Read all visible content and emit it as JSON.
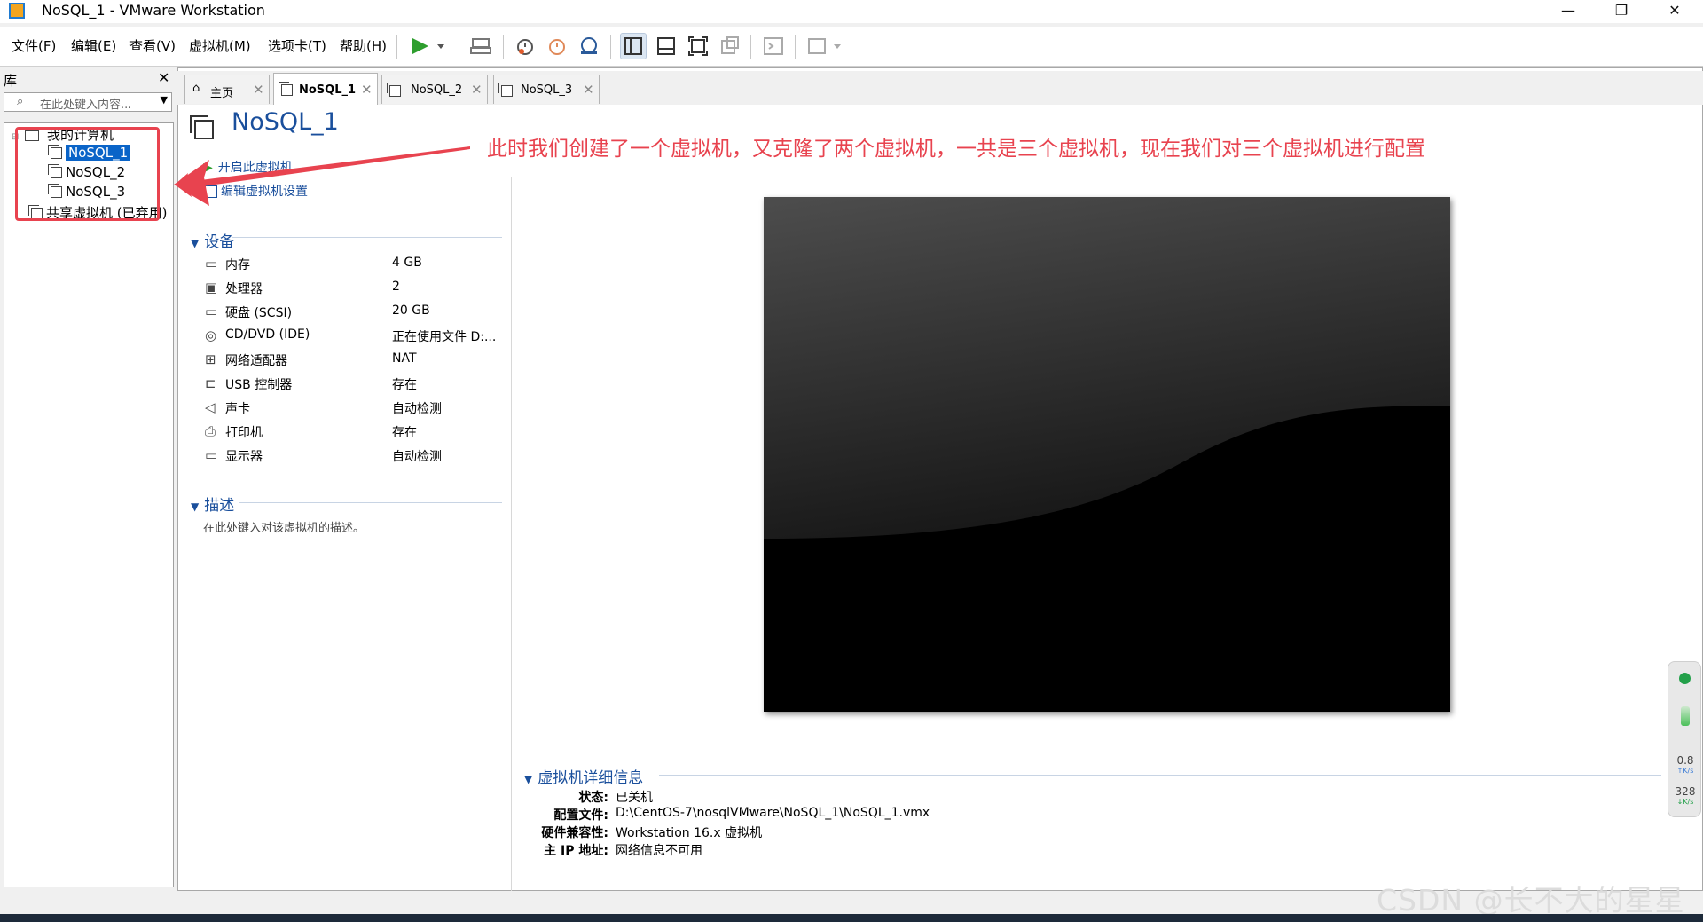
{
  "window": {
    "title": "NoSQL_1 - VMware Workstation",
    "controls": [
      "—",
      "❐",
      "✕"
    ]
  },
  "menu": [
    "文件(F)",
    "编辑(E)",
    "查看(V)",
    "虚拟机(M)",
    "选项卡(T)",
    "帮助(H)"
  ],
  "library": {
    "header": "库",
    "close": "✕",
    "search_placeholder": "在此处键入内容...",
    "tree": {
      "root": "我的计算机",
      "vms": [
        "NoSQL_1",
        "NoSQL_2",
        "NoSQL_3"
      ],
      "shared": "共享虚拟机 (已弃用)"
    }
  },
  "tabs": [
    {
      "label": "主页",
      "icon": "home-icon"
    },
    {
      "label": "NoSQL_1",
      "icon": "vm-icon"
    },
    {
      "label": "NoSQL_2",
      "icon": "vm-icon"
    },
    {
      "label": "NoSQL_3",
      "icon": "vm-icon"
    }
  ],
  "vm": {
    "name": "NoSQL_1",
    "actions": {
      "power_on": "开启此虚拟机",
      "edit_settings": "编辑虚拟机设置"
    },
    "devices_title": "设备",
    "devices": [
      {
        "name": "内存",
        "value": "4 GB",
        "icon": "memory-icon"
      },
      {
        "name": "处理器",
        "value": "2",
        "icon": "cpu-icon"
      },
      {
        "name": "硬盘 (SCSI)",
        "value": "20 GB",
        "icon": "disk-icon"
      },
      {
        "name": "CD/DVD (IDE)",
        "value": "正在使用文件 D:...",
        "icon": "cd-icon"
      },
      {
        "name": "网络适配器",
        "value": "NAT",
        "icon": "network-icon"
      },
      {
        "name": "USB 控制器",
        "value": "存在",
        "icon": "usb-icon"
      },
      {
        "name": "声卡",
        "value": "自动检测",
        "icon": "sound-icon"
      },
      {
        "name": "打印机",
        "value": "存在",
        "icon": "printer-icon"
      },
      {
        "name": "显示器",
        "value": "自动检测",
        "icon": "display-icon"
      }
    ],
    "description_title": "描述",
    "description_placeholder": "在此处键入对该虚拟机的描述。",
    "details_title": "虚拟机详细信息",
    "details": [
      {
        "label": "状态:",
        "value": "已关机"
      },
      {
        "label": "配置文件:",
        "value": "D:\\CentOS-7\\nosqlVMware\\NoSQL_1\\NoSQL_1.vmx"
      },
      {
        "label": "硬件兼容性:",
        "value": "Workstation 16.x 虚拟机"
      },
      {
        "label": "主 IP 地址:",
        "value": "网络信息不可用"
      }
    ]
  },
  "annotation": "此时我们创建了一个虚拟机，又克隆了两个虚拟机，一共是三个虚拟机，现在我们对三个虚拟机进行配置",
  "net_widget": {
    "up": "0.8",
    "up_unit": "K/s",
    "down": "328",
    "down_unit": "K/s"
  },
  "watermark": "CSDN @长不大的星星",
  "colors": {
    "accent": "#1a4f9c",
    "annotation": "#e8434f",
    "selection": "#0a64c8"
  }
}
